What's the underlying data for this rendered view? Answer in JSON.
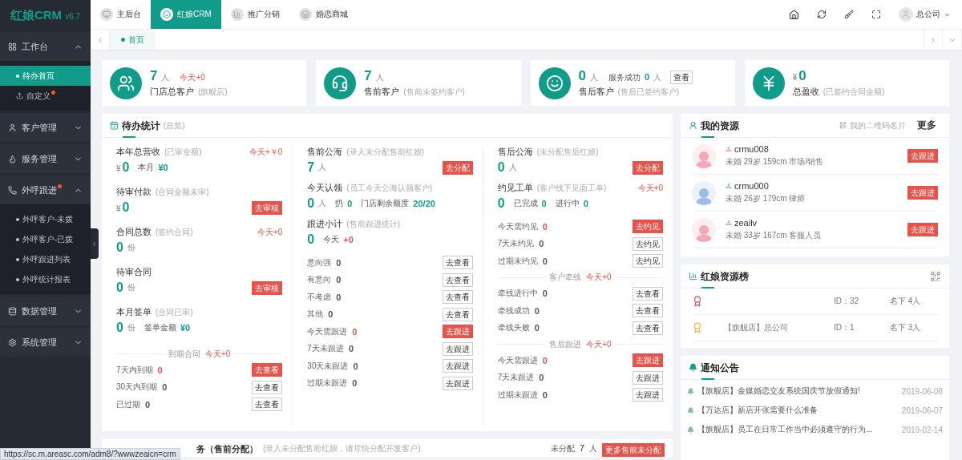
{
  "sidebar": {
    "logo": "红娘CRM",
    "version": "v6.7",
    "menu": [
      {
        "label": "工作台",
        "expanded": true,
        "dot": false,
        "children": [
          {
            "label": "待办首页",
            "kind": "bullet",
            "selected": true,
            "dot": false
          },
          {
            "label": "自定义",
            "kind": "icon",
            "selected": false,
            "dot": true
          }
        ]
      },
      {
        "label": "客户管理",
        "expanded": false,
        "dot": false
      },
      {
        "label": "服务管理",
        "expanded": false,
        "dot": false
      },
      {
        "label": "外呼跟进",
        "expanded": true,
        "dot": true,
        "children": [
          {
            "label": "外呼客户-未拨",
            "kind": "bullet",
            "selected": false,
            "dot": false
          },
          {
            "label": "外呼客户-已拨",
            "kind": "bullet",
            "selected": false,
            "dot": false
          },
          {
            "label": "外呼跟进列表",
            "kind": "bullet",
            "selected": false,
            "dot": false
          },
          {
            "label": "外呼统计报表",
            "kind": "bullet",
            "selected": false,
            "dot": false
          }
        ]
      },
      {
        "label": "数据管理",
        "expanded": false,
        "dot": false
      },
      {
        "label": "系统管理",
        "expanded": false,
        "dot": false
      }
    ]
  },
  "topnav": {
    "tabs": [
      {
        "label": "主后台",
        "selected": false
      },
      {
        "label": "红娘CRM",
        "selected": true
      },
      {
        "label": "推广分销",
        "selected": false
      },
      {
        "label": "婚恋商城",
        "selected": false
      }
    ],
    "user": "总公司"
  },
  "pagetabs": [
    {
      "label": "首页",
      "selected": true
    }
  ],
  "cards": [
    {
      "value": "7",
      "unit": "人",
      "today": "今天+0",
      "label": "门店总客户",
      "note": "(旗舰店)"
    },
    {
      "value": "7",
      "unit": "人",
      "label": "售前客户",
      "note": "(售前未签约客户)"
    },
    {
      "value": "0",
      "unit": "人",
      "extra_label": "服务成功",
      "extra_value": "0",
      "extra_unit": "人",
      "button": "查看",
      "label": "售后客户",
      "note": "(售后已签约客户)"
    },
    {
      "prefix": "¥",
      "value": "0",
      "label": "总盈收",
      "note": "(已签约合同金额)"
    }
  ],
  "todo": {
    "title": "待办统计",
    "note": "(总览)",
    "columns": [
      [
        {
          "kind": "stat",
          "title": "本年总营收",
          "note": "(已审金额)",
          "today": "今天+￥0",
          "prefix": "¥",
          "value": "0",
          "extras": [
            {
              "label": "本月",
              "value": "¥0",
              "alert": false
            }
          ]
        },
        {
          "kind": "stat",
          "title": "待审付款",
          "note": "(合同金额未审)",
          "prefix": "¥",
          "value": "0",
          "button": {
            "text": "去审核",
            "primary": true
          }
        },
        {
          "kind": "stat",
          "title": "合同总数",
          "note": "(签约合同)",
          "today": "今天+0",
          "value": "0",
          "unit": "份"
        },
        {
          "kind": "stat",
          "title": "待审合同",
          "value": "0",
          "unit": "份",
          "button": {
            "text": "去审核",
            "primary": true
          }
        },
        {
          "kind": "stat",
          "title": "本月签单",
          "note": "(合同已审)",
          "value": "0",
          "unit": "份",
          "extras": [
            {
              "label": "签单金额",
              "value": "¥0",
              "alert": false
            }
          ]
        },
        {
          "kind": "divider",
          "label": "到期合同",
          "today": "今天+0"
        },
        {
          "kind": "row",
          "label": "7天内到期",
          "value": "0",
          "alert": true,
          "button": {
            "text": "去查看",
            "primary": true
          }
        },
        {
          "kind": "row",
          "label": "30天内到期",
          "value": "0",
          "alert": false,
          "button": {
            "text": "去查看",
            "primary": false
          }
        },
        {
          "kind": "row",
          "label": "已过期",
          "value": "0",
          "alert": false,
          "button": {
            "text": "去查看",
            "primary": false
          }
        }
      ],
      [
        {
          "kind": "stat",
          "title": "售前公海",
          "note": "(录入未分配售前红娘)",
          "value": "7",
          "unit": "人",
          "button": {
            "text": "去分配",
            "primary": true
          }
        },
        {
          "kind": "stat",
          "title": "今天认领",
          "note": "(员工今天公海认领客户)",
          "value": "0",
          "unit": "人",
          "extras": [
            {
              "label": "扔",
              "value": "0",
              "alert": false
            },
            {
              "label": "门店剩余额度",
              "value": "20/20",
              "alert": false
            }
          ]
        },
        {
          "kind": "stat",
          "title": "跟进小计",
          "note": "(售前跟进统计)",
          "value": "0",
          "extras": [
            {
              "label": "今天",
              "value": "+0",
              "alert": true
            }
          ]
        },
        {
          "kind": "row",
          "label": "意向强",
          "value": "0",
          "alert": false,
          "button": {
            "text": "去查看",
            "primary": false
          }
        },
        {
          "kind": "row",
          "label": "有意向",
          "value": "0",
          "alert": false,
          "button": {
            "text": "去查看",
            "primary": false
          }
        },
        {
          "kind": "row",
          "label": "不考虑",
          "value": "0",
          "alert": false,
          "button": {
            "text": "去查看",
            "primary": false
          }
        },
        {
          "kind": "row",
          "label": "其他",
          "value": "0",
          "alert": false,
          "button": {
            "text": "去查看",
            "primary": false
          }
        },
        {
          "kind": "row",
          "label": "今天需跟进",
          "value": "0",
          "alert": true,
          "button": {
            "text": "去跟进",
            "primary": true
          }
        },
        {
          "kind": "row",
          "label": "7天未跟进",
          "value": "0",
          "alert": false,
          "button": {
            "text": "去跟进",
            "primary": false
          }
        },
        {
          "kind": "row",
          "label": "30天未跟进",
          "value": "0",
          "alert": false,
          "button": {
            "text": "去跟进",
            "primary": false
          }
        },
        {
          "kind": "row",
          "label": "过期未跟进",
          "value": "0",
          "alert": false,
          "button": {
            "text": "去跟进",
            "primary": false
          }
        }
      ],
      [
        {
          "kind": "stat",
          "title": "售后公海",
          "note": "(未分配售后红娘)",
          "value": "0",
          "unit": "人",
          "button": {
            "text": "去分配",
            "primary": true
          }
        },
        {
          "kind": "stat",
          "title": "约见工单",
          "note": "(客户线下见面工单)",
          "today": "今天+0",
          "value": "0",
          "extras": [
            {
              "label": "已完成",
              "value": "0",
              "alert": false
            },
            {
              "label": "进行中",
              "value": "0",
              "alert": false
            }
          ]
        },
        {
          "kind": "row",
          "label": "今天需约见",
          "value": "0",
          "alert": true,
          "button": {
            "text": "去约见",
            "primary": true
          }
        },
        {
          "kind": "row",
          "label": "7天未约见",
          "value": "0",
          "alert": false,
          "button": {
            "text": "去约见",
            "primary": false
          }
        },
        {
          "kind": "row",
          "label": "过期未约见",
          "value": "0",
          "alert": false,
          "button": {
            "text": "去约见",
            "primary": false
          }
        },
        {
          "kind": "divider",
          "label": "客户牵线",
          "today": "今天+0"
        },
        {
          "kind": "row",
          "label": "牵线进行中",
          "value": "0",
          "alert": false,
          "button": {
            "text": "去查看",
            "primary": false
          }
        },
        {
          "kind": "row",
          "label": "牵线成功",
          "value": "0",
          "alert": false,
          "button": {
            "text": "去查看",
            "primary": false
          }
        },
        {
          "kind": "row",
          "label": "牵线失败",
          "value": "0",
          "alert": false,
          "button": {
            "text": "去查看",
            "primary": false
          }
        },
        {
          "kind": "divider",
          "label": "售后跟进",
          "today": "今天+0"
        },
        {
          "kind": "row",
          "label": "今天需跟进",
          "value": "0",
          "alert": true,
          "button": {
            "text": "去跟进",
            "primary": true
          }
        },
        {
          "kind": "row",
          "label": "7天未跟进",
          "value": "0",
          "alert": false,
          "button": {
            "text": "去跟进",
            "primary": false
          }
        },
        {
          "kind": "row",
          "label": "过期未跟进",
          "value": "0",
          "alert": false,
          "button": {
            "text": "去跟进",
            "primary": false
          }
        }
      ]
    ]
  },
  "resources": {
    "title": "我的资源",
    "qr_link": "我的二维码名片",
    "more": "更多",
    "items": [
      {
        "name": "crmu008",
        "color": "#f3a8b8",
        "info": "未婚 29岁 159cm 市场/销售",
        "button": "去跟进"
      },
      {
        "name": "crmu000",
        "color": "#9ebde6",
        "info": "未婚 26岁 179cm 律师",
        "button": "去跟进"
      },
      {
        "name": "zeailv",
        "color": "#f3a8b8",
        "info": "未婚 33岁 167cm 客服人员",
        "button": "去跟进"
      }
    ]
  },
  "ranking": {
    "title": "红娘资源榜",
    "rows": [
      {
        "color": "#e0524b",
        "id": "ID：32",
        "count": "名下 4人"
      },
      {
        "color": "#f0b93a",
        "name": "【旗舰店】总公司",
        "id": "ID：1",
        "count": "名下 3人"
      }
    ]
  },
  "notices": {
    "title": "通知公告",
    "items": [
      {
        "text": "【旗舰店】金媒婚恋交友系统国庆节放假通知!",
        "date": "2019-06-08"
      },
      {
        "text": "【万达店】新店开张需要什么准备",
        "date": "2019-06-07"
      },
      {
        "text": "【旗舰店】员工在日常工作当中必须遵守的行为...",
        "date": "2019-02-14"
      }
    ]
  },
  "assign": {
    "title": "务（售前分配）",
    "note": "(录入未分配售前红娘，请尽快分配开发客户)",
    "count_label": "未分配",
    "count": "7",
    "count_unit": "人",
    "button": "更多售前未分配"
  },
  "status_url": "https://sc.m.areasc.com/adm8/?wwwzeaicn=crm"
}
